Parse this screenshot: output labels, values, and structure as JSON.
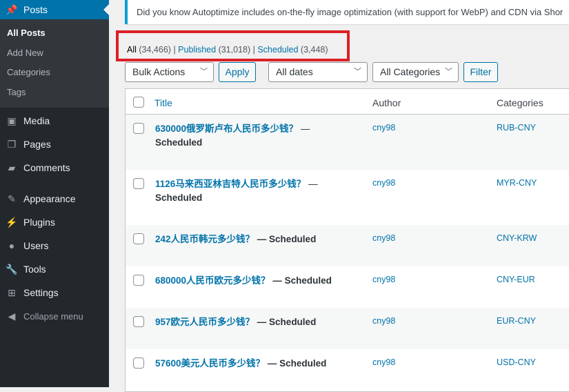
{
  "sidebar": {
    "posts": "Posts",
    "sub": [
      "All Posts",
      "Add New",
      "Categories",
      "Tags"
    ],
    "items": [
      {
        "label": "Media",
        "icon": "media-icon"
      },
      {
        "label": "Pages",
        "icon": "pages-icon"
      },
      {
        "label": "Comments",
        "icon": "comments-icon"
      },
      {
        "label": "Appearance",
        "icon": "appearance-icon"
      },
      {
        "label": "Plugins",
        "icon": "plugins-icon"
      },
      {
        "label": "Users",
        "icon": "users-icon"
      },
      {
        "label": "Tools",
        "icon": "tools-icon"
      },
      {
        "label": "Settings",
        "icon": "settings-icon"
      }
    ],
    "collapse": "Collapse menu"
  },
  "notice": "Did you know Autoptimize includes on-the-fly image optimization (with support for WebP) and CDN via Shor",
  "views": {
    "all": "All",
    "all_count": "(34,466)",
    "published": "Published",
    "published_count": "(31,018)",
    "scheduled": "Scheduled",
    "scheduled_count": "(3,448)",
    "sep": "|"
  },
  "toolbar": {
    "bulk": "Bulk Actions",
    "apply": "Apply",
    "dates": "All dates",
    "cats": "All Categories",
    "filter": "Filter"
  },
  "columns": {
    "title": "Title",
    "author": "Author",
    "categories": "Categories"
  },
  "rows": [
    {
      "title": "630000俄罗斯卢布人民币多少钱？",
      "state": "— Scheduled",
      "author": "cny98",
      "cat": "RUB-CNY"
    },
    {
      "title": "1126马来西亚林吉特人民币多少钱？",
      "state": "— Scheduled",
      "author": "cny98",
      "cat": "MYR-CNY"
    },
    {
      "title": "242人民币韩元多少钱？",
      "state": "— Scheduled",
      "author": "cny98",
      "cat": "CNY-KRW"
    },
    {
      "title": "680000人民币欧元多少钱？",
      "state": "— Scheduled",
      "author": "cny98",
      "cat": "CNY-EUR"
    },
    {
      "title": "957欧元人民币多少钱？",
      "state": "— Scheduled",
      "author": "cny98",
      "cat": "EUR-CNY"
    },
    {
      "title": "57600美元人民币多少钱？",
      "state": "— Scheduled",
      "author": "cny98",
      "cat": "USD-CNY"
    }
  ]
}
